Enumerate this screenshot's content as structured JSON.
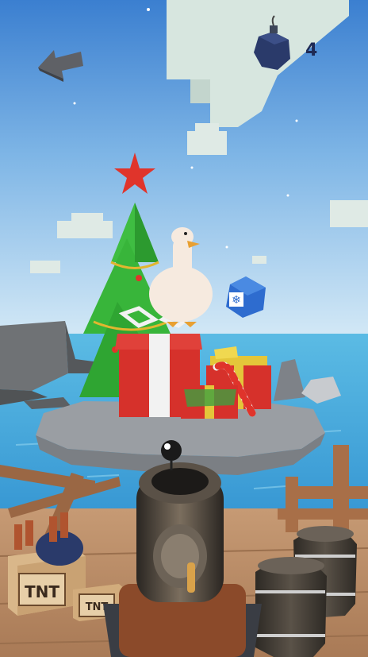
{
  "hud": {
    "back_icon": "back-arrow-icon",
    "bomb_icon": "bomb-icon",
    "bomb_count": "4"
  },
  "scene": {
    "crate_label": "TNT",
    "crate_label_small": "TNT"
  },
  "colors": {
    "sky_top": "#5ea8e8",
    "sky_bottom": "#cfe7f7",
    "sea": "#3fa5d6",
    "deck": "#b98a66",
    "tree": "#38b53a",
    "gift_red": "#d6312b",
    "star": "#e0342b",
    "bomb": "#2a3a6a",
    "snowflake_cube": "#2e6ccf"
  }
}
